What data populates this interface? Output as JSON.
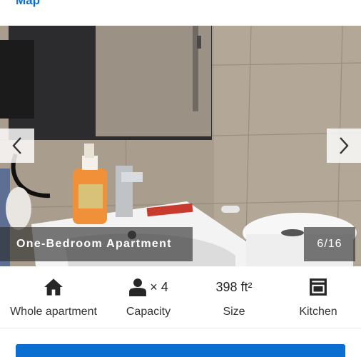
{
  "top_link": {
    "label": "Map"
  },
  "gallery": {
    "caption": "One-Bedroom Apartment",
    "counter": "6/16",
    "prev_icon": "chevron-left-icon",
    "next_icon": "chevron-right-icon"
  },
  "facts": [
    {
      "icon": "house-icon",
      "value": "",
      "label": "Whole apartment"
    },
    {
      "icon": "person-icon",
      "value": "× 4",
      "label": "Capacity"
    },
    {
      "icon": "",
      "value": "398 ft²",
      "label": "Size"
    },
    {
      "icon": "stove-icon",
      "value": "",
      "label": "Kitchen"
    }
  ],
  "colors": {
    "accent": "#0b6fd1",
    "overlay": "#282828"
  }
}
